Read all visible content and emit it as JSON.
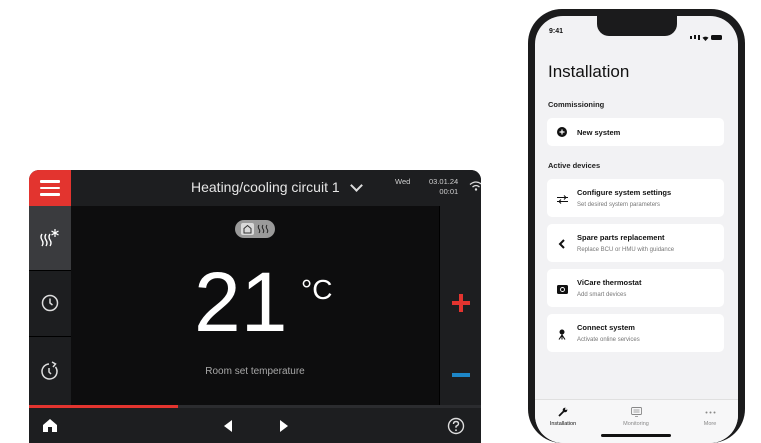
{
  "controller": {
    "title": "Heating/cooling circuit 1",
    "day": "Wed",
    "date": "03.01.24",
    "time": "00:01",
    "mode_icons": [
      "house-icon",
      "radiator-heat-icon"
    ],
    "temperature": "21",
    "unit": "°C",
    "set_label": "Room set temperature",
    "progress_fraction": 0.33,
    "colors": {
      "accent": "#e3342f",
      "minus": "#1d86c7",
      "panel": "#1d1e20"
    }
  },
  "phone": {
    "status_time": "9:41",
    "title": "Installation",
    "sections": {
      "commissioning": "Commissioning",
      "active_devices": "Active devices"
    },
    "new_system": {
      "title": "New system",
      "icon": "plus-circle-icon"
    },
    "items": [
      {
        "title": "Configure system settings",
        "subtitle": "Set desired system parameters",
        "icon": "sliders-icon"
      },
      {
        "title": "Spare parts replacement",
        "subtitle": "Replace BCU or HMU with guidance",
        "icon": "wrench-icon"
      },
      {
        "title": "ViCare thermostat",
        "subtitle": "Add smart devices",
        "icon": "thermostat-icon"
      },
      {
        "title": "Connect system",
        "subtitle": "Activate online services",
        "icon": "antenna-icon"
      }
    ],
    "tabs": [
      {
        "label": "Installation",
        "icon": "wrench-icon",
        "active": true
      },
      {
        "label": "Monitoring",
        "icon": "monitor-icon",
        "active": false
      },
      {
        "label": "More",
        "icon": "more-icon",
        "active": false
      }
    ]
  }
}
